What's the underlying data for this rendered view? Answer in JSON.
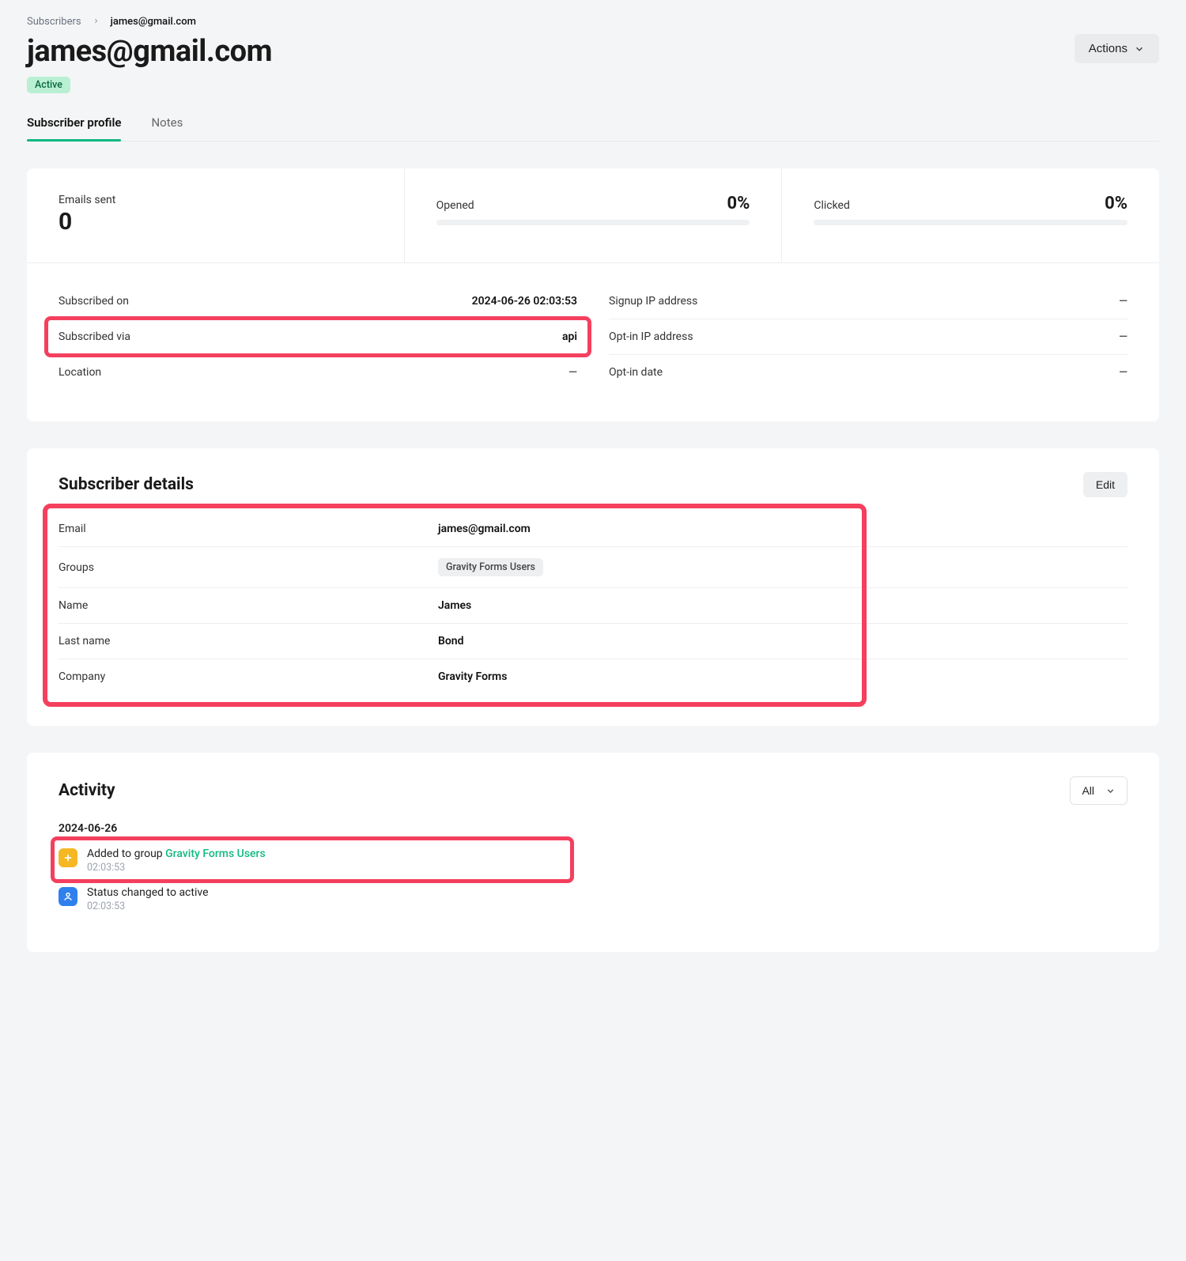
{
  "breadcrumb": {
    "root": "Subscribers",
    "current": "james@gmail.com"
  },
  "header": {
    "title": "james@gmail.com",
    "actions_label": "Actions",
    "status": "Active"
  },
  "tabs": {
    "profile": "Subscriber profile",
    "notes": "Notes"
  },
  "stats": {
    "emails_sent_label": "Emails sent",
    "emails_sent_value": "0",
    "opened_label": "Opened",
    "opened_value": "0%",
    "clicked_label": "Clicked",
    "clicked_value": "0%"
  },
  "info_left": {
    "subscribed_on_k": "Subscribed on",
    "subscribed_on_v": "2024-06-26 02:03:53",
    "subscribed_via_k": "Subscribed via",
    "subscribed_via_v": "api",
    "location_k": "Location",
    "location_v": "—"
  },
  "info_right": {
    "signup_ip_k": "Signup IP address",
    "signup_ip_v": "—",
    "optin_ip_k": "Opt-in IP address",
    "optin_ip_v": "—",
    "optin_date_k": "Opt-in date",
    "optin_date_v": "—"
  },
  "details": {
    "title": "Subscriber details",
    "edit_label": "Edit",
    "email_k": "Email",
    "email_v": "james@gmail.com",
    "groups_k": "Groups",
    "groups_v": "Gravity Forms Users",
    "name_k": "Name",
    "name_v": "James",
    "lastname_k": "Last name",
    "lastname_v": "Bond",
    "company_k": "Company",
    "company_v": "Gravity Forms"
  },
  "activity": {
    "title": "Activity",
    "filter_label": "All",
    "date": "2024-06-26",
    "item1_pre": "Added to group ",
    "item1_link": "Gravity Forms Users",
    "item1_time": "02:03:53",
    "item2_text": "Status changed to active",
    "item2_time": "02:03:53"
  }
}
